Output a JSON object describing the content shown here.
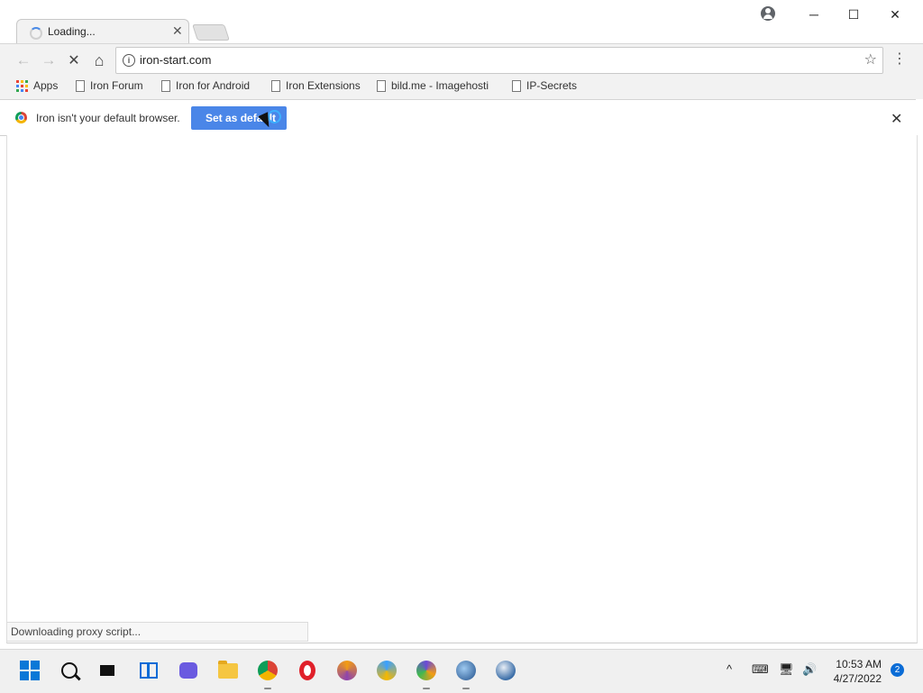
{
  "tab": {
    "title": "Loading...",
    "close": "✕"
  },
  "window_controls": {
    "minimize": "─",
    "maximize": "☐",
    "close": "✕"
  },
  "toolbar": {
    "back": "←",
    "forward": "→",
    "stop": "✕",
    "home": "⌂",
    "info": "i",
    "url": "iron-start.com",
    "star": "☆",
    "menu": "⋮"
  },
  "bookmarks": [
    {
      "label": "Apps"
    },
    {
      "label": "Iron Forum"
    },
    {
      "label": "Iron for Android"
    },
    {
      "label": "Iron Extensions"
    },
    {
      "label": "bild.me - Imagehosti"
    },
    {
      "label": "IP-Secrets"
    }
  ],
  "infobar": {
    "message": "Iron isn't your default browser.",
    "button": "Set as default",
    "close": "✕"
  },
  "status": "Downloading proxy script...",
  "taskbar": {
    "time": "10:53 AM",
    "date": "4/27/2022",
    "notifications": "2",
    "tray_up": "^",
    "keyboard": "⌨",
    "network": "🖥",
    "volume": "🔊"
  },
  "colors": {
    "accent": "#4a86e8",
    "start": "#0a78d7",
    "apps_grid": [
      "#ea4335",
      "#fbbc05",
      "#34a853",
      "#4285f4",
      "#ea4335",
      "#fbbc05",
      "#34a853",
      "#4285f4",
      "#ea4335"
    ]
  }
}
